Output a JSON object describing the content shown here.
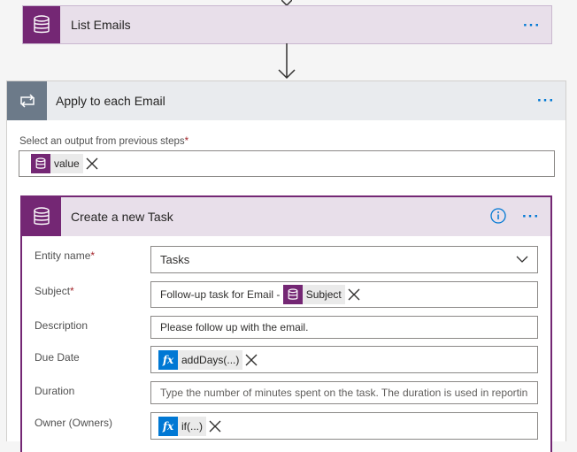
{
  "colors": {
    "accent": "#742774",
    "link": "#0078d4",
    "loop": "#6c7a89",
    "required": "#a4262c"
  },
  "list_emails": {
    "title": "List Emails",
    "icon": "database-icon",
    "more_label": "···"
  },
  "apply_each": {
    "title": "Apply to each Email",
    "icon": "loop-icon",
    "more_label": "···",
    "select_label": "Select an output from previous steps",
    "required_mark": "*",
    "selected_token": {
      "label": "value",
      "icon": "database-icon"
    }
  },
  "create_task": {
    "title": "Create a new Task",
    "icon": "database-icon",
    "info_icon": "info-icon",
    "more_label": "···",
    "fields": {
      "entity": {
        "label": "Entity name",
        "required_mark": "*",
        "value": "Tasks"
      },
      "subject": {
        "label": "Subject",
        "required_mark": "*",
        "prefix": "Follow-up task for Email - ",
        "token": "Subject"
      },
      "description": {
        "label": "Description",
        "value": "Please follow up with the email."
      },
      "due_date": {
        "label": "Due Date",
        "token": "addDays(...)",
        "token_icon": "fx"
      },
      "duration": {
        "label": "Duration",
        "placeholder": "Type the number of minutes spent on the task. The duration is used in reportin"
      },
      "owner": {
        "label": "Owner (Owners)",
        "token": "if(...)",
        "token_icon": "fx"
      }
    }
  }
}
